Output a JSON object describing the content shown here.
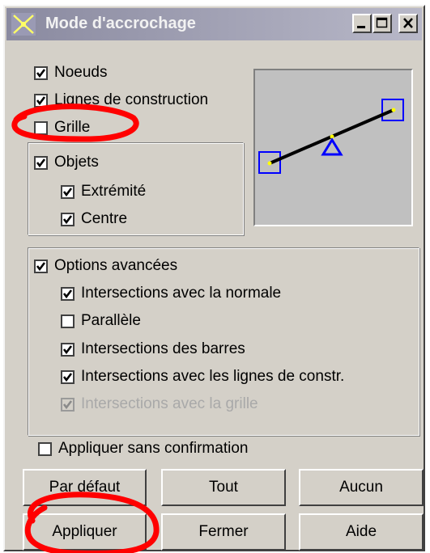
{
  "window": {
    "title": "Mode d'accrochage",
    "minimize_icon": "minimize-icon",
    "maximize_icon": "maximize-icon",
    "close_icon": "close-icon"
  },
  "snap_options": {
    "noeuds": {
      "label": "Noeuds",
      "checked": true
    },
    "lignes_construction": {
      "label": "Lignes de construction",
      "checked": true
    },
    "grille": {
      "label": "Grille",
      "checked": false
    },
    "objets": {
      "label": "Objets",
      "checked": true
    },
    "extremite": {
      "label": "Extrémité",
      "checked": true
    },
    "centre": {
      "label": "Centre",
      "checked": true
    }
  },
  "advanced": {
    "options_avancees": {
      "label": "Options avancées",
      "checked": true
    },
    "normale": {
      "label": "Intersections avec la normale",
      "checked": true
    },
    "parallele": {
      "label": "Parallèle",
      "checked": false
    },
    "barres": {
      "label": "Intersections des barres",
      "checked": true
    },
    "lignes_constr": {
      "label": "Intersections avec les lignes de constr.",
      "checked": true
    },
    "grille": {
      "label": "Intersections avec la grille",
      "checked": true,
      "disabled": true
    }
  },
  "apply_without_confirmation": {
    "label": "Appliquer sans confirmation",
    "checked": false
  },
  "buttons": {
    "par_defaut": "Par défaut",
    "tout": "Tout",
    "aucun": "Aucun",
    "appliquer": "Appliquer",
    "fermer": "Fermer",
    "aide": "Aide"
  },
  "colors": {
    "dialog_bg": "#d4d0c8",
    "preview_bg": "#c0c0c0",
    "annotation_red": "#ff0000",
    "snap_blue": "#0000ff"
  }
}
